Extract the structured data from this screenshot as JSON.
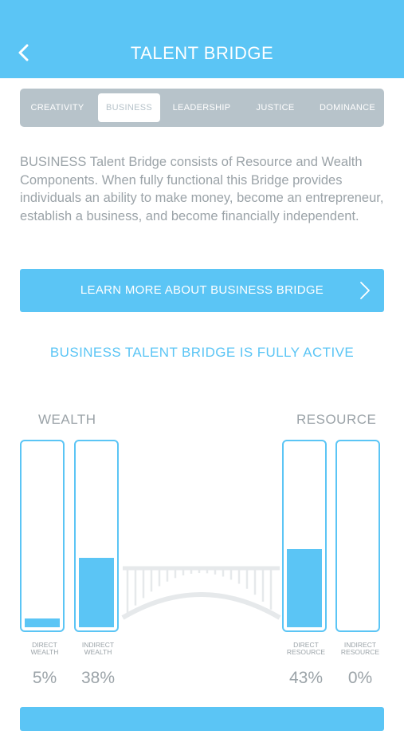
{
  "header": {
    "title": "TALENT BRIDGE"
  },
  "tabs": [
    {
      "label": "CREATIVITY",
      "active": false
    },
    {
      "label": "BUSINESS",
      "active": true
    },
    {
      "label": "LEADERSHIP",
      "active": false
    },
    {
      "label": "JUSTICE",
      "active": false
    },
    {
      "label": "DOMINANCE",
      "active": false
    }
  ],
  "description": "BUSINESS Talent Bridge consists of Resource and Wealth Components. When fully functional this Bridge provides individuals an ability to make money, become an entrepreneur, establish a business, and become financially independent.",
  "learn_button": {
    "label": "LEARN MORE ABOUT BUSINESS BRIDGE"
  },
  "status": "BUSINESS TALENT BRIDGE IS FULLY ACTIVE",
  "wealth": {
    "label": "WEALTH",
    "bars": [
      {
        "line1": "DIRECT",
        "line2": "WEALTH",
        "value": 5,
        "pct": "5%"
      },
      {
        "line1": "INDIRECT",
        "line2": "WEALTH",
        "value": 38,
        "pct": "38%"
      }
    ]
  },
  "resource": {
    "label": "RESOURCE",
    "bars": [
      {
        "line1": "DIRECT",
        "line2": "RESOURCE",
        "value": 43,
        "pct": "43%"
      },
      {
        "line1": "INDIRECT",
        "line2": "RESOURCE",
        "value": 0,
        "pct": "0%"
      }
    ]
  },
  "colors": {
    "accent": "#5bc5f5",
    "tab_bar": "#b7c3ca",
    "text_gray": "#9ba3a8",
    "bridge": "#e6e9eb"
  },
  "icons": {
    "back": "chevron-left-icon",
    "learn_more": "chevron-right-icon"
  }
}
